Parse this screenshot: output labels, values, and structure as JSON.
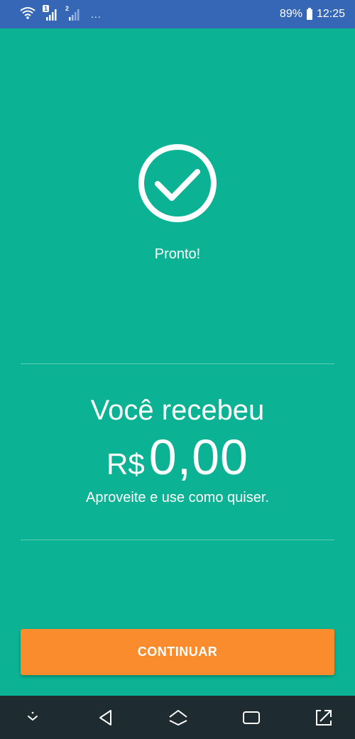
{
  "status_bar": {
    "sim1": "1",
    "sim2": "2",
    "more": "...",
    "battery": "89%",
    "time": "12:25",
    "icons": [
      "wifi-icon",
      "signal-icon",
      "signal-icon",
      "battery-icon"
    ]
  },
  "success": {
    "icon": "check-circle-icon",
    "label": "Pronto!"
  },
  "received": {
    "title": "Você recebeu",
    "currency": "R$",
    "amount": "0,00",
    "subtitle": "Aproveite e use como quiser."
  },
  "button": {
    "label": "CONTINUAR"
  },
  "nav_bar": {
    "icons": [
      "chevron-down-icon",
      "back-icon",
      "home-icon",
      "recents-icon",
      "expand-icon"
    ]
  },
  "colors": {
    "background": "#0bb294",
    "status_bar": "#3667b6",
    "button": "#fb8c2d",
    "nav_bar": "#1e2b31",
    "text": "#ffffff"
  }
}
